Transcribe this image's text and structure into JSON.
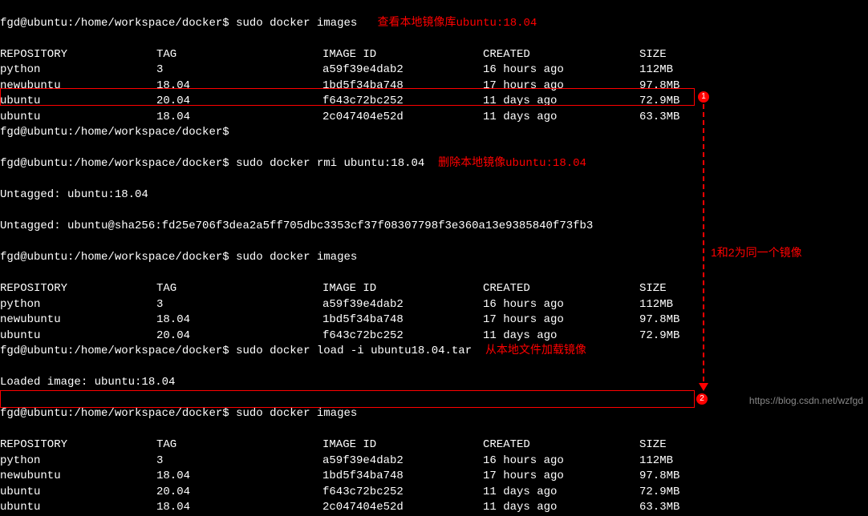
{
  "prompt": "fgd@ubuntu:/home/workspace/docker$",
  "commands": {
    "images": "sudo docker images",
    "rmi": "sudo docker rmi ubuntu:18.04",
    "load": "sudo docker load -i ubuntu18.04.tar"
  },
  "annotations": {
    "view_local": "查看本地镜像库ubuntu:18.04",
    "delete_local": "删除本地镜像ubuntu:18.04",
    "load_from_file": "从本地文件加载镜像",
    "same_image": "1和2为同一个镜像",
    "badge1": "1",
    "badge2": "2"
  },
  "headers": {
    "repo": "REPOSITORY",
    "tag": "TAG",
    "image_id": "IMAGE ID",
    "created": "CREATED",
    "size": "SIZE"
  },
  "table1": [
    {
      "repo": "python",
      "tag": "3",
      "id": "a59f39e4dab2",
      "created": "16 hours ago",
      "size": "112MB"
    },
    {
      "repo": "newubuntu",
      "tag": "18.04",
      "id": "1bd5f34ba748",
      "created": "17 hours ago",
      "size": "97.8MB"
    },
    {
      "repo": "ubuntu",
      "tag": "20.04",
      "id": "f643c72bc252",
      "created": "11 days ago",
      "size": "72.9MB"
    },
    {
      "repo": "ubuntu",
      "tag": "18.04",
      "id": "2c047404e52d",
      "created": "11 days ago",
      "size": "63.3MB"
    }
  ],
  "rmi_output": {
    "untagged1": "Untagged: ubuntu:18.04",
    "untagged2": "Untagged: ubuntu@sha256:fd25e706f3dea2a5ff705dbc3353cf37f08307798f3e360a13e9385840f73fb3"
  },
  "table2": [
    {
      "repo": "python",
      "tag": "3",
      "id": "a59f39e4dab2",
      "created": "16 hours ago",
      "size": "112MB"
    },
    {
      "repo": "newubuntu",
      "tag": "18.04",
      "id": "1bd5f34ba748",
      "created": "17 hours ago",
      "size": "97.8MB"
    },
    {
      "repo": "ubuntu",
      "tag": "20.04",
      "id": "f643c72bc252",
      "created": "11 days ago",
      "size": "72.9MB"
    }
  ],
  "load_output": "Loaded image: ubuntu:18.04",
  "table3": [
    {
      "repo": "python",
      "tag": "3",
      "id": "a59f39e4dab2",
      "created": "16 hours ago",
      "size": "112MB"
    },
    {
      "repo": "newubuntu",
      "tag": "18.04",
      "id": "1bd5f34ba748",
      "created": "17 hours ago",
      "size": "97.8MB"
    },
    {
      "repo": "ubuntu",
      "tag": "20.04",
      "id": "f643c72bc252",
      "created": "11 days ago",
      "size": "72.9MB"
    },
    {
      "repo": "ubuntu",
      "tag": "18.04",
      "id": "2c047404e52d",
      "created": "11 days ago",
      "size": "63.3MB"
    }
  ],
  "watermark": "https://blog.csdn.net/wzfgd"
}
